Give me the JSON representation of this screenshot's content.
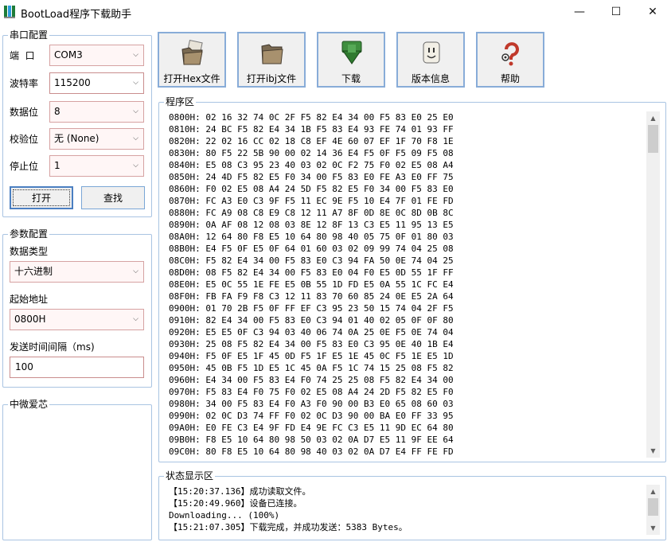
{
  "window": {
    "title": "BootLoad程序下载助手",
    "minimize": "—",
    "maximize": "☐",
    "close": "✕"
  },
  "serial": {
    "title": "串口配置",
    "port_label": "端  口",
    "port_value": "COM3",
    "baud_label": "波特率",
    "baud_value": "115200",
    "databits_label": "数据位",
    "databits_value": "8",
    "parity_label": "校验位",
    "parity_value": "无 (None)",
    "stopbits_label": "停止位",
    "stopbits_value": "1",
    "open_button": "打开",
    "find_button": "查找"
  },
  "params": {
    "title": "参数配置",
    "datatype_label": "数据类型",
    "datatype_value": "十六进制",
    "start_label": "起始地址",
    "start_value": "0800H",
    "interval_label": "发送时间间隔（ms)",
    "interval_value": "100"
  },
  "aside": {
    "title": "中微爱芯"
  },
  "toolbar": {
    "open_hex": "打开Hex文件",
    "open_ibj": "打开ibj文件",
    "download": "下载",
    "version": "版本信息",
    "help": "帮助"
  },
  "program": {
    "title": "程序区",
    "lines": [
      "0800H: 02 16 32 74 0C 2F F5 82 E4 34 00 F5 83 E0 25 E0",
      "0810H: 24 BC F5 82 E4 34 1B F5 83 E4 93 FE 74 01 93 FF",
      "0820H: 22 02 16 CC 02 18 C8 EF 4E 60 07 EF 1F 70 F8 1E",
      "0830H: 80 F5 22 5B 90 00 02 14 36 E4 F5 0F F5 09 F5 08",
      "0840H: E5 08 C3 95 23 40 03 02 0C F2 75 F0 02 E5 08 A4",
      "0850H: 24 4D F5 82 E5 F0 34 00 F5 83 E0 FE A3 E0 FF 75",
      "0860H: F0 02 E5 08 A4 24 5D F5 82 E5 F0 34 00 F5 83 E0",
      "0870H: FC A3 E0 C3 9F F5 11 EC 9E F5 10 E4 7F 01 FE FD",
      "0880H: FC A9 08 C8 E9 C8 12 11 A7 8F 0D 8E 0C 8D 0B 8C",
      "0890H: 0A AF 08 12 08 03 8E 12 8F 13 C3 E5 11 95 13 E5",
      "08A0H: 12 64 80 F8 E5 10 64 80 98 40 05 75 0F 01 80 03",
      "08B0H: E4 F5 0F E5 0F 64 01 60 03 02 09 99 74 04 25 08",
      "08C0H: F5 82 E4 34 00 F5 83 E0 C3 94 FA 50 0E 74 04 25",
      "08D0H: 08 F5 82 E4 34 00 F5 83 E0 04 F0 E5 0D 55 1F FF",
      "08E0H: E5 0C 55 1E FE E5 0B 55 1D FD E5 0A 55 1C FC E4",
      "08F0H: FB FA F9 F8 C3 12 11 83 70 60 85 24 0E E5 2A 64",
      "0900H: 01 70 2B F5 0F FF EF C3 95 23 50 15 74 04 2F F5",
      "0910H: 82 E4 34 00 F5 83 E0 C3 94 01 40 02 05 0F 0F 80",
      "0920H: E5 E5 0F C3 94 03 40 06 74 0A 25 0E F5 0E 74 04",
      "0930H: 25 08 F5 82 E4 34 00 F5 83 E0 C3 95 0E 40 1B E4",
      "0940H: F5 0F E5 1F 45 0D F5 1F E5 1E 45 0C F5 1E E5 1D",
      "0950H: 45 0B F5 1D E5 1C 45 0A F5 1C 74 15 25 08 F5 82",
      "0960H: E4 34 00 F5 83 E4 F0 74 25 25 08 F5 82 E4 34 00",
      "0970H: F5 83 E4 F0 75 F0 02 E5 08 A4 24 2D F5 82 E5 F0",
      "0980H: 34 00 F5 83 E4 F0 A3 F0 90 00 B3 E0 65 08 60 03",
      "0990H: 02 0C D3 74 FF F0 02 0C D3 90 00 BA E0 FF 33 95",
      "09A0H: E0 FE C3 E4 9F FD E4 9E FC C3 E5 11 9D EC 64 80",
      "09B0H: F8 E5 10 64 80 98 50 03 02 0A D7 E5 11 9F EE 64",
      "09C0H: 80 F8 E5 10 64 80 98 40 03 02 0A D7 E4 FF FE FD"
    ]
  },
  "status": {
    "title": "状态显示区",
    "lines": [
      "【15:20:37.136】成功读取文件。",
      "【15:20:49.960】设备已连接。",
      "Downloading... (100%)",
      "【15:21:07.305】下载完成，并成功发送：5383 Bytes。"
    ]
  },
  "icons": {
    "dropdown": "chevron-down-icon",
    "scroll_up": "scroll-up-icon",
    "scroll_down": "scroll-down-icon"
  }
}
